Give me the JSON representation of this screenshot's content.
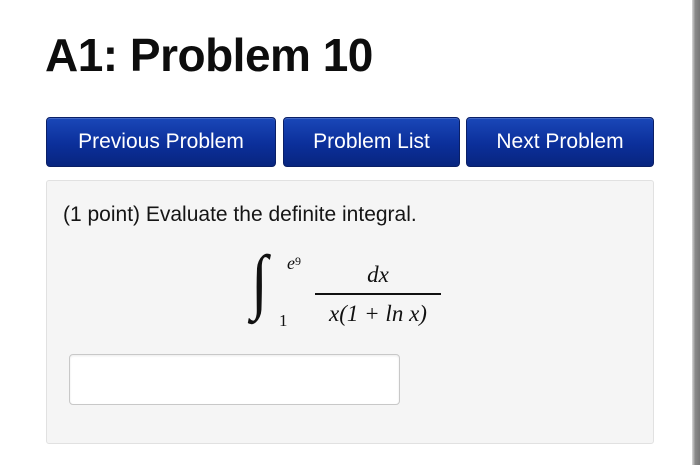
{
  "page": {
    "title": "A1: Problem 10"
  },
  "nav": {
    "previous_label": "Previous Problem",
    "list_label": "Problem List",
    "next_label": "Next Problem",
    "button_color": "#0b2f9a"
  },
  "problem": {
    "text": "(1 point) Evaluate the definite integral.",
    "math": {
      "integral_symbol": "∫",
      "upper_limit_base": "e",
      "upper_limit_exponent": "9",
      "lower_limit": "1",
      "numerator": "dx",
      "denominator": "x(1 + ln x)"
    },
    "answer_value": "",
    "answer_placeholder": ""
  }
}
